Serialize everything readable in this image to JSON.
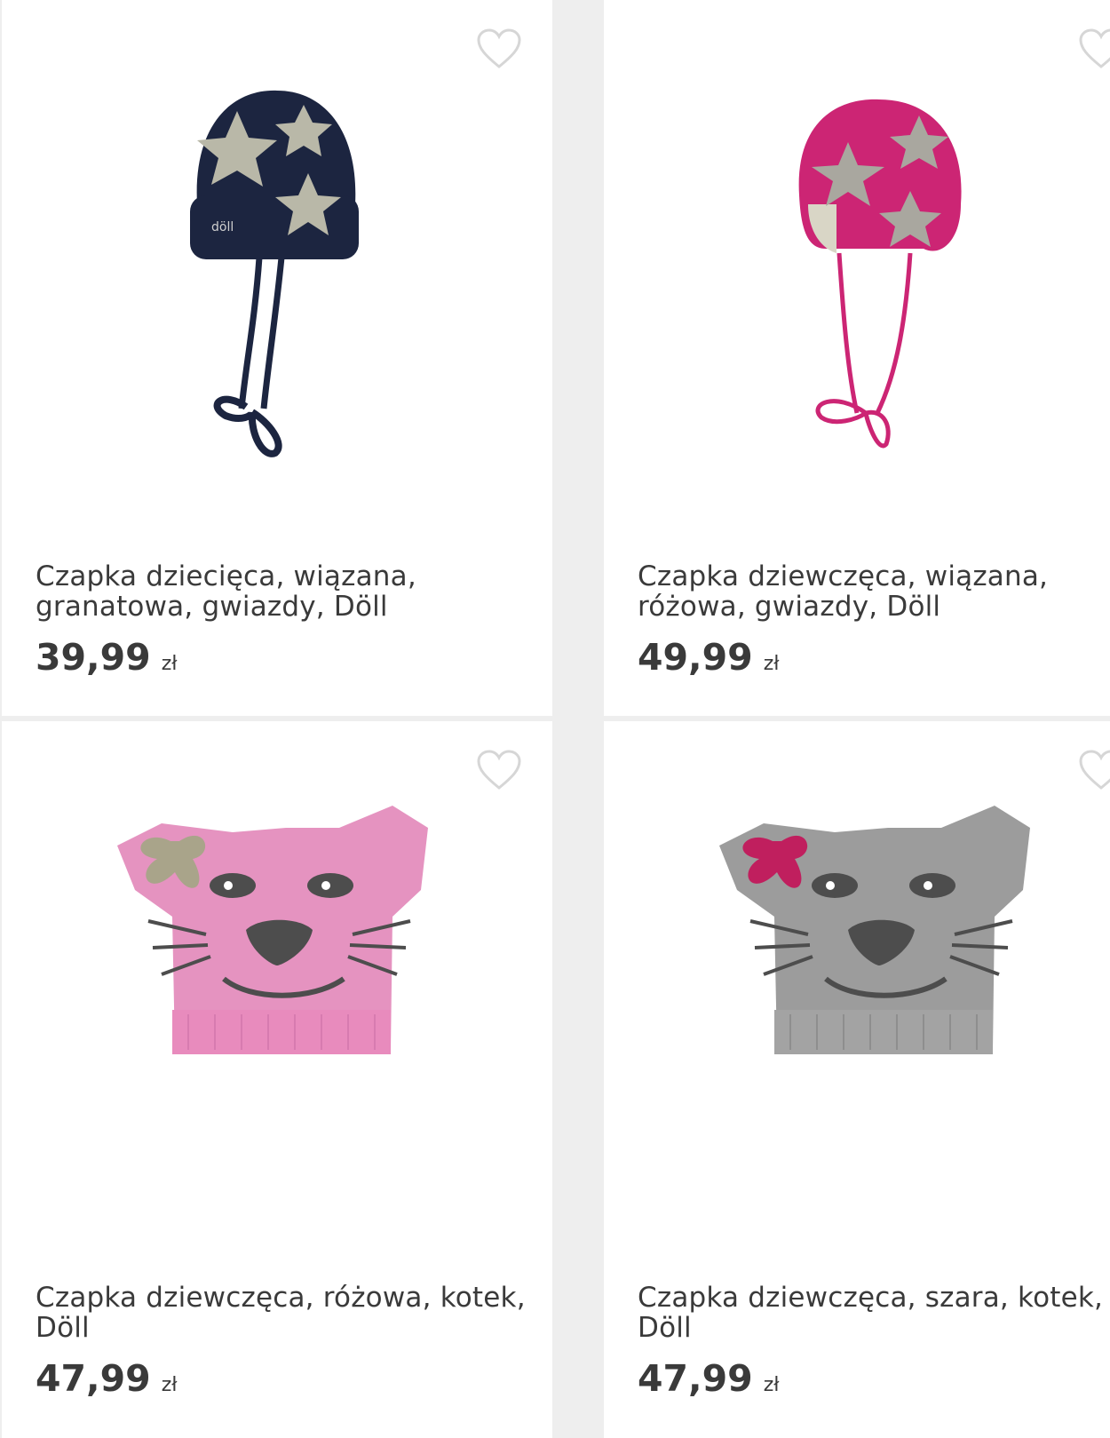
{
  "products": [
    {
      "title": "Czapka dziecięca, wiązana, granatowa, gwiazdy, Döll",
      "price": "39,99",
      "currency": "zł",
      "image_icon": "navy-star-hat-image"
    },
    {
      "title": "Czapka dziewczęca, wiązana, różowa, gwiazdy, Döll",
      "price": "49,99",
      "currency": "zł",
      "image_icon": "pink-star-hat-image"
    },
    {
      "title": "Czapka dziewczęca, różowa, kotek, Döll",
      "price": "47,99",
      "currency": "zł",
      "image_icon": "pink-cat-hat-image"
    },
    {
      "title": "Czapka dziewczęca, szara, kotek, Döll",
      "price": "47,99",
      "currency": "zł",
      "image_icon": "grey-cat-hat-image"
    }
  ],
  "colors": {
    "background": "#eeeeee",
    "card": "#ffffff",
    "text": "#3a3a3a",
    "heart": "#d6d6d6"
  },
  "favorite_icon": "heart-outline-icon"
}
